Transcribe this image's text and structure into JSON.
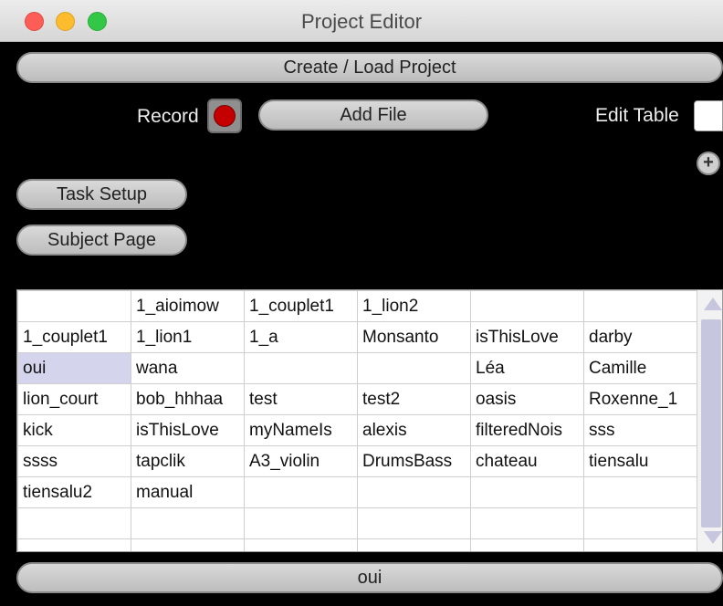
{
  "window": {
    "title": "Project Editor"
  },
  "toolbar": {
    "create_load_label": "Create / Load Project",
    "record_label": "Record",
    "add_file_label": "Add File",
    "edit_table_label": "Edit Table",
    "plus_label": "+",
    "task_setup_label": "Task Setup",
    "subject_page_label": "Subject Page"
  },
  "table": {
    "rows": [
      [
        "",
        "1_aioimow",
        "1_couplet1",
        "1_lion2",
        "",
        ""
      ],
      [
        "1_couplet1",
        "1_lion1",
        "1_a",
        "Monsanto",
        "isThisLove",
        "darby"
      ],
      [
        "oui",
        "wana",
        "",
        "",
        "Léa",
        "Camille"
      ],
      [
        "lion_court",
        "bob_hhhaa",
        "test",
        "test2",
        "oasis",
        "Roxenne_1"
      ],
      [
        "kick",
        "isThisLove",
        "myNameIs",
        "alexis",
        "filteredNois",
        "sss"
      ],
      [
        "ssss",
        "tapclik",
        "A3_violin",
        "DrumsBass",
        "chateau",
        "tiensalu"
      ],
      [
        "tiensalu2",
        "manual",
        "",
        "",
        "",
        ""
      ],
      [
        "",
        "",
        "",
        "",
        "",
        ""
      ],
      [
        "",
        "",
        "",
        "",
        "",
        ""
      ]
    ],
    "selected_cell": "oui"
  },
  "footer": {
    "selection_label": "oui"
  },
  "colors": {
    "background": "#000000",
    "record": "#c40000",
    "selection": "#d4d4ec"
  }
}
